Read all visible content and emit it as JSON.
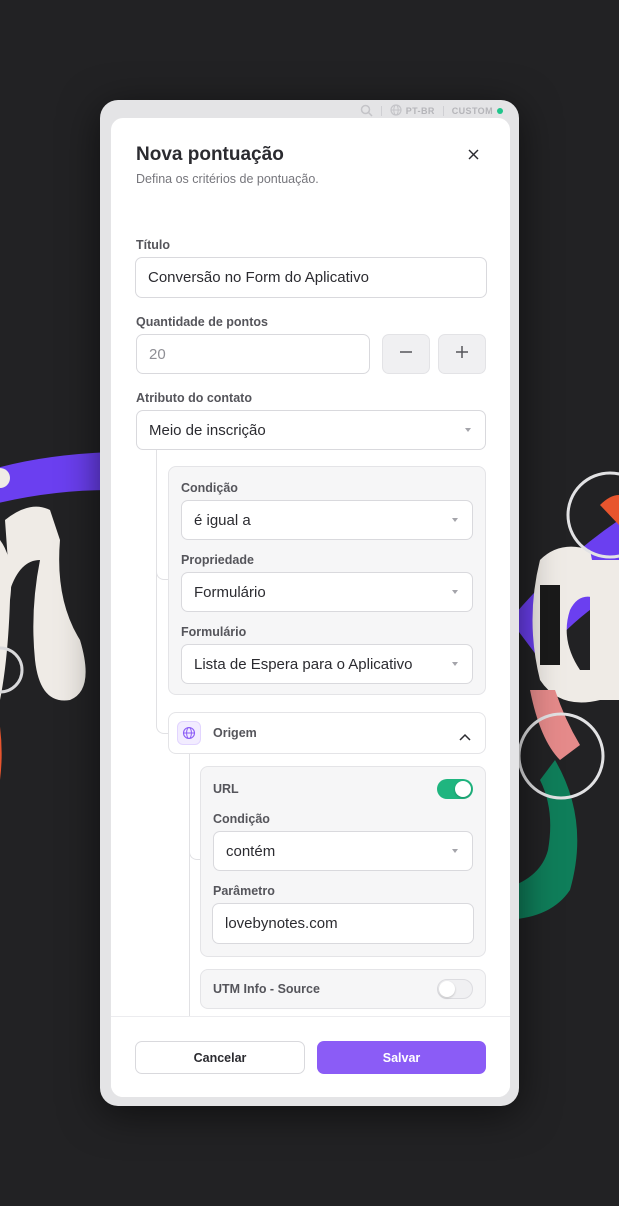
{
  "topbar": {
    "language": "PT-BR",
    "custom_label": "CUSTOM",
    "status_color": "#1fc58b"
  },
  "modal": {
    "title": "Nova pontuação",
    "subtitle": "Defina os critérios de pontuação."
  },
  "form": {
    "title_label": "Título",
    "title_value": "Conversão no Form do Aplicativo",
    "points_label": "Quantidade de pontos",
    "points_placeholder": "20",
    "attribute_label": "Atributo do contato",
    "attribute_value": "Meio de inscrição",
    "condition_label": "Condição",
    "condition_value": "é igual a",
    "property_label": "Propriedade",
    "property_value": "Formulário",
    "form_label": "Formulário",
    "form_value": "Lista de Espera para o Aplicativo"
  },
  "origin": {
    "title": "Origem",
    "icon": "globe-icon",
    "url": {
      "label": "URL",
      "enabled": true,
      "condition_label": "Condição",
      "condition_value": "contém",
      "parameter_label": "Parâmetro",
      "parameter_value": "lovebynotes.com"
    },
    "utm_source": {
      "label": "UTM Info - Source",
      "enabled": false
    }
  },
  "footer": {
    "cancel_label": "Cancelar",
    "save_label": "Salvar"
  },
  "colors": {
    "accent": "#8b5cf6",
    "toggle_on": "#1fb57f"
  }
}
